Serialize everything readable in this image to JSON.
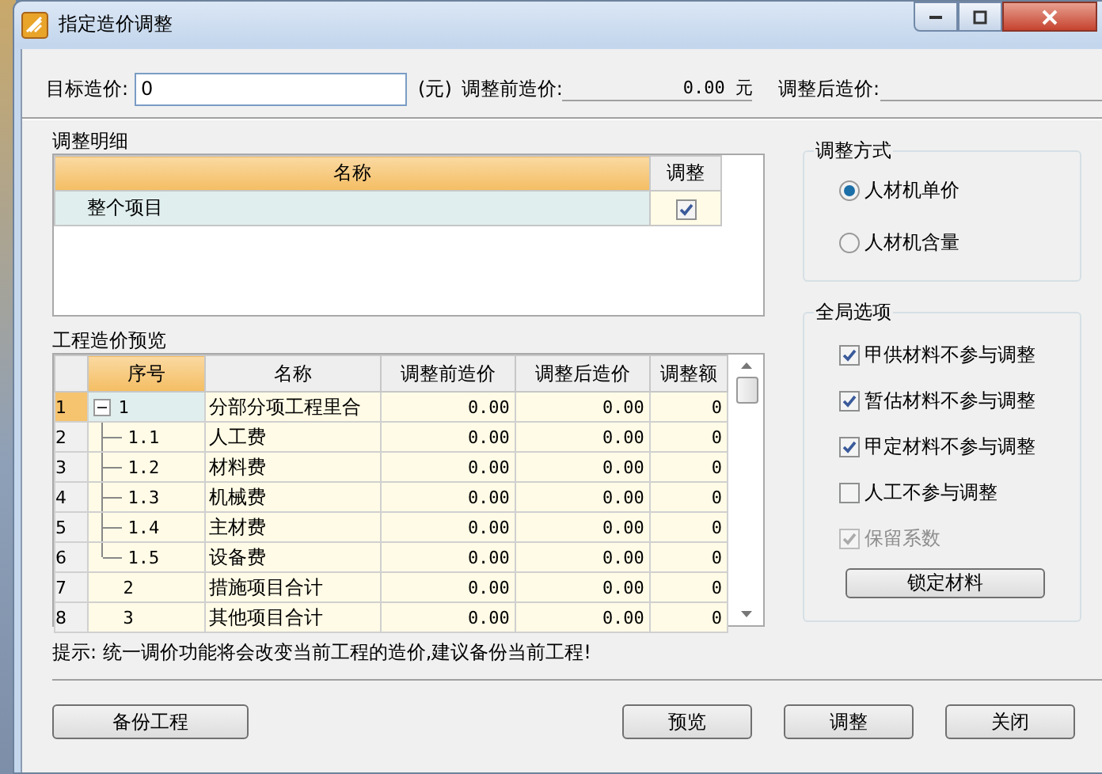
{
  "window": {
    "title": "指定造价调整"
  },
  "target": {
    "label": "目标造价:",
    "value": "0",
    "unit": "(元)",
    "before_label": "调整前造价:",
    "before_value": "0.00 元",
    "after_label": "调整后造价:"
  },
  "detail": {
    "title": "调整明细",
    "columns": [
      "名称",
      "调整"
    ],
    "rows": [
      {
        "name": "整个项目",
        "checked": true,
        "selected": true
      }
    ]
  },
  "preview": {
    "title": "工程造价预览",
    "columns": [
      "序号",
      "名称",
      "调整前造价",
      "调整后造价",
      "调整额"
    ],
    "rows": [
      {
        "num": "1",
        "seq": "1",
        "name": "分部分项工程里合",
        "before": "0.00",
        "after": "0.00",
        "diff": "0",
        "selected": true,
        "expanded": true,
        "children": [
          {
            "num": "2",
            "seq": "1.1",
            "name": "人工费",
            "before": "0.00",
            "after": "0.00",
            "diff": "0",
            "selected": false
          },
          {
            "num": "3",
            "seq": "1.2",
            "name": "材料费",
            "before": "0.00",
            "after": "0.00",
            "diff": "0",
            "selected": false
          },
          {
            "num": "4",
            "seq": "1.3",
            "name": "机械费",
            "before": "0.00",
            "after": "0.00",
            "diff": "0",
            "selected": false
          },
          {
            "num": "5",
            "seq": "1.4",
            "name": "主材费",
            "before": "0.00",
            "after": "0.00",
            "diff": "0",
            "selected": false
          },
          {
            "num": "6",
            "seq": "1.5",
            "name": "设备费",
            "before": "0.00",
            "after": "0.00",
            "diff": "0",
            "selected": false
          }
        ]
      },
      {
        "num": "7",
        "seq": "2",
        "name": "措施项目合计",
        "before": "0.00",
        "after": "0.00",
        "diff": "0",
        "selected": false
      },
      {
        "num": "8",
        "seq": "3",
        "name": "其他项目合计",
        "before": "0.00",
        "after": "0.00",
        "diff": "0",
        "selected": false
      }
    ]
  },
  "mode": {
    "title": "调整方式",
    "options": [
      {
        "label": "人材机单价",
        "selected": true
      },
      {
        "label": "人材机含量",
        "selected": false
      }
    ]
  },
  "options": {
    "title": "全局选项",
    "items": [
      {
        "label": "甲供材料不参与调整",
        "checked": true,
        "disabled": false
      },
      {
        "label": "暂估材料不参与调整",
        "checked": true,
        "disabled": false
      },
      {
        "label": "甲定材料不参与调整",
        "checked": true,
        "disabled": false
      },
      {
        "label": "人工不参与调整",
        "checked": false,
        "disabled": false
      },
      {
        "label": "保留系数",
        "checked": true,
        "disabled": true
      }
    ],
    "button": "锁定材料"
  },
  "hint": "提示: 统一调价功能将会改变当前工程的造价,建议备份当前工程!",
  "buttons_left": [
    "备份工程"
  ],
  "buttons_right": [
    "预览",
    "调整",
    "关闭"
  ]
}
